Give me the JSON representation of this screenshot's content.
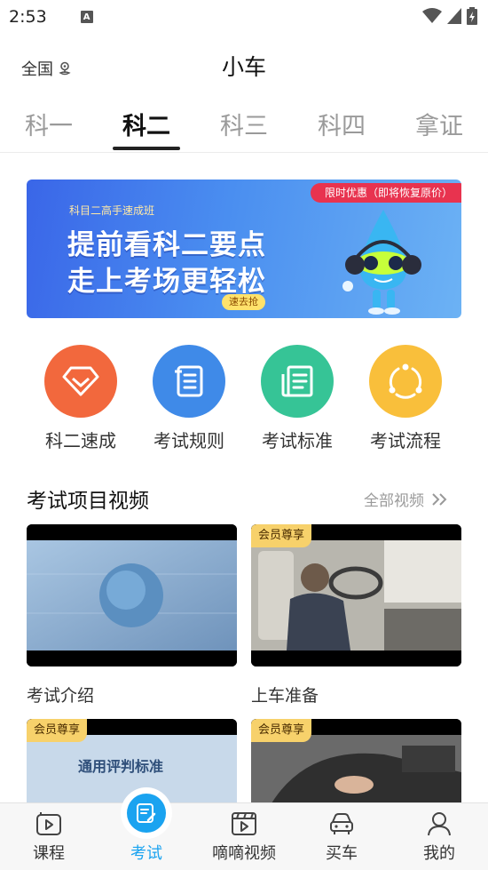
{
  "status_bar": {
    "time": "2:53",
    "notification_glyph": "A"
  },
  "header": {
    "region": "全国",
    "title": "小车"
  },
  "tabs": [
    {
      "label": "科一"
    },
    {
      "label": "科二",
      "active": true
    },
    {
      "label": "科三"
    },
    {
      "label": "科四"
    },
    {
      "label": "拿证"
    }
  ],
  "banner": {
    "promo_tag": "限时优惠（即将恢复原价）",
    "subtitle": "科目二高手速成班",
    "line1": "提前看科二要点",
    "line2": "走上考场更轻松",
    "button": "速去抢"
  },
  "quick_entries": [
    {
      "label": "科二速成",
      "icon": "diamond-icon",
      "color": "#f2683d"
    },
    {
      "label": "考试规则",
      "icon": "scroll-icon",
      "color": "#3f8ae8"
    },
    {
      "label": "考试标准",
      "icon": "document-icon",
      "color": "#36c496"
    },
    {
      "label": "考试流程",
      "icon": "flow-cycle-icon",
      "color": "#f9bf3b"
    }
  ],
  "videos_section": {
    "title": "考试项目视频",
    "more": "全部视频",
    "items": [
      {
        "caption": "考试介绍",
        "badge": ""
      },
      {
        "caption": "上车准备",
        "badge": "会员尊享"
      },
      {
        "caption": "",
        "badge": "会员尊享",
        "overlay_text": "通用评判标准"
      },
      {
        "caption": "",
        "badge": "会员尊享"
      }
    ]
  },
  "bottom_nav": [
    {
      "label": "课程",
      "icon": "course-icon"
    },
    {
      "label": "考试",
      "icon": "exam-icon",
      "active": true
    },
    {
      "label": "嘀嘀视频",
      "icon": "video-icon"
    },
    {
      "label": "买车",
      "icon": "car-icon"
    },
    {
      "label": "我的",
      "icon": "profile-icon"
    }
  ],
  "colors": {
    "accent": "#1aa3f0",
    "promo": "#e8334f",
    "vip": "#f7d16b"
  }
}
